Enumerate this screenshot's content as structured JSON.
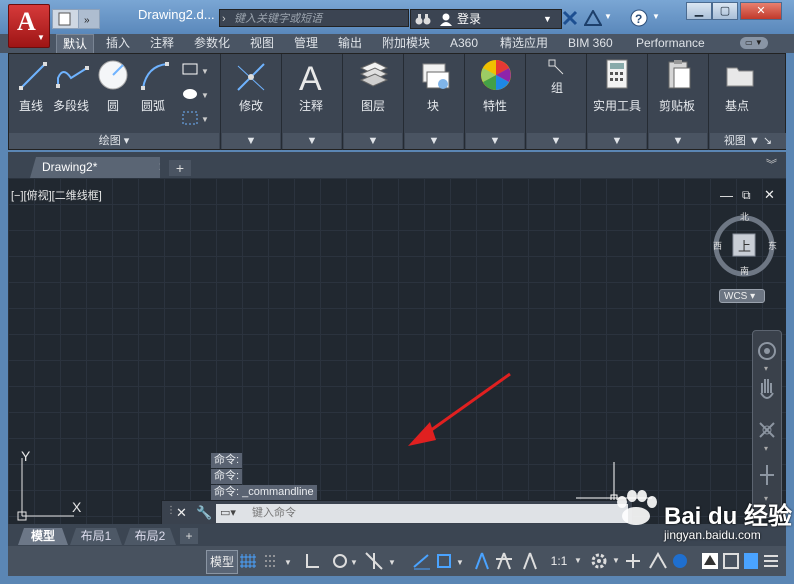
{
  "titlebar": {
    "app_letter": "A",
    "document_title": "Drawing2.d...",
    "search_placeholder": "键入关键字或短语",
    "login_label": "登录"
  },
  "ribbon_tabs": [
    "默认",
    "插入",
    "注释",
    "参数化",
    "视图",
    "管理",
    "输出",
    "附加模块",
    "A360",
    "精选应用",
    "BIM 360",
    "Performance"
  ],
  "ribbon": {
    "draw": {
      "line": "直线",
      "polyline": "多段线",
      "circle": "圆",
      "arc": "圆弧",
      "panel_title": "绘图"
    },
    "modify": "修改",
    "annotation": "注释",
    "layers": "图层",
    "block": "块",
    "properties": "特性",
    "groups": "组",
    "utilities": "实用工具",
    "clipboard": "剪贴板",
    "base": "基点",
    "view_panel": "视图"
  },
  "file_tab": {
    "label": "Drawing2*"
  },
  "viewport": {
    "label": "[−][俯视][二维线框]"
  },
  "viewcube": {
    "north": "北",
    "south": "南",
    "east": "东",
    "west": "西",
    "top": "上",
    "wcs": "WCS"
  },
  "ucs": {
    "x": "X",
    "y": "Y"
  },
  "command": {
    "history": [
      "命令:",
      "命令:",
      "命令: _commandline"
    ],
    "placeholder": "键入命令"
  },
  "layout_tabs": [
    "模型",
    "布局1",
    "布局2"
  ],
  "statusbar": {
    "model": "模型",
    "scale": "1:1"
  },
  "watermark": {
    "text": "Bai du 经验",
    "url": "jingyan.baidu.com"
  }
}
